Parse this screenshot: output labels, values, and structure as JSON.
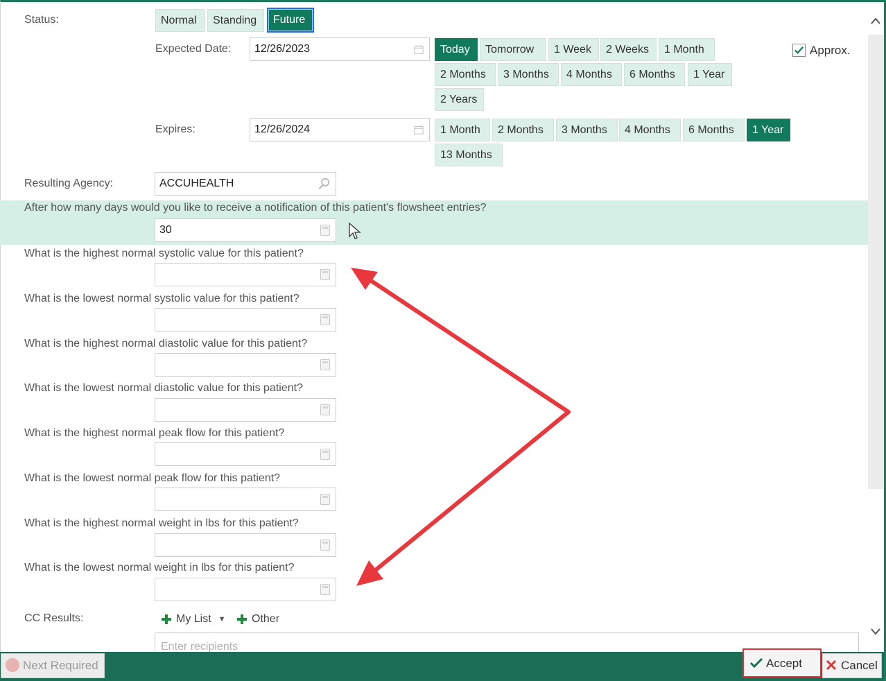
{
  "status": {
    "label": "Status:",
    "options": [
      "Normal",
      "Standing",
      "Future"
    ],
    "selected": "Future"
  },
  "expected_date": {
    "label": "Expected Date:",
    "value": "12/26/2023",
    "quick": [
      "Today",
      "Tomorrow",
      "1 Week",
      "2 Weeks",
      "1 Month",
      "2 Months",
      "3 Months",
      "4 Months",
      "6 Months",
      "1 Year",
      "2 Years"
    ],
    "selected": "Today",
    "approx_label": "Approx.",
    "approx_checked": true
  },
  "expires": {
    "label": "Expires:",
    "value": "12/26/2024",
    "quick": [
      "1 Month",
      "2 Months",
      "3 Months",
      "4 Months",
      "6 Months",
      "1 Year",
      "13 Months"
    ],
    "selected": "1 Year"
  },
  "resulting_agency": {
    "label": "Resulting Agency:",
    "value": "ACCUHEALTH"
  },
  "notification": {
    "question": "After how many days would you like to receive a notification of this patient's flowsheet entries?",
    "value": "30"
  },
  "questions": [
    "What is the highest normal systolic value for this patient?",
    "What is the lowest normal systolic value for this patient?",
    "What is the highest normal diastolic value for this patient?",
    "What is the lowest normal diastolic value for this patient?",
    "What is the highest normal peak flow for this patient?",
    "What is the lowest normal peak flow for this patient?",
    "What is the highest normal weight in lbs for this patient?",
    "What is the lowest normal weight in lbs for this patient?"
  ],
  "cc_results": {
    "label": "CC Results:",
    "my_list": "My List",
    "other": "Other",
    "placeholder": "Enter recipients"
  },
  "footer": {
    "next_required": "Next Required",
    "accept": "Accept",
    "cancel": "Cancel"
  },
  "colors": {
    "accent": "#127a5c",
    "bar": "#1b6e55",
    "band": "#d5efe7",
    "arrow": "#e8383d"
  },
  "icons": {
    "calendar": "calendar-icon",
    "search": "magnifier-icon",
    "calculator": "calculator-icon",
    "check": "check-icon",
    "plus": "plus-icon",
    "close": "x-icon"
  }
}
